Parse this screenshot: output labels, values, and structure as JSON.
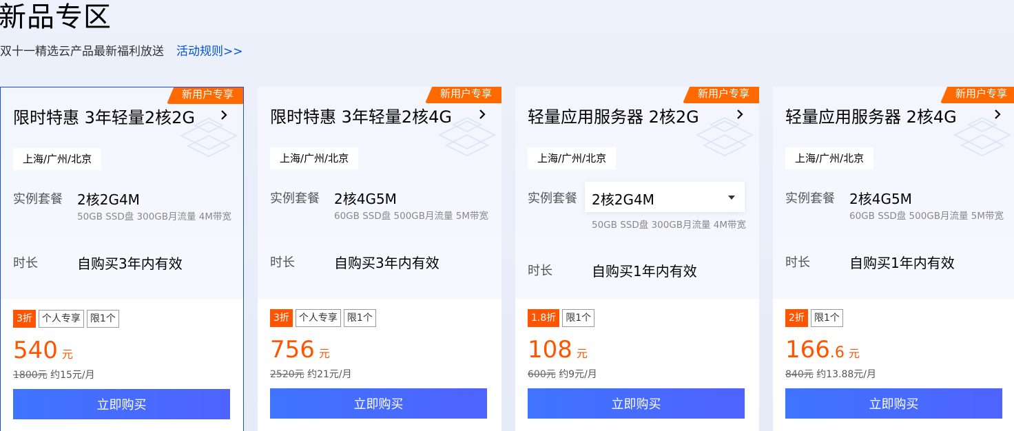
{
  "header": {
    "title": "新品专区",
    "subtitle": "双十一精选云产品最新福利放送",
    "rules_link": "活动规则>>"
  },
  "cards": [
    {
      "badge": "新用户专享",
      "title": "限时特惠 3年轻量2核2G",
      "region": "上海/广州/北京",
      "spec_label": "实例套餐",
      "spec_value": "2核2G4M",
      "spec_desc": "50GB SSD盘 300GB月流量 4M带宽",
      "duration_label": "时长",
      "duration_value": "自购买3年内有效",
      "tags": [
        "3折",
        "个人专享",
        "限1个"
      ],
      "price_int": "540",
      "price_dec": "",
      "price_unit": "元",
      "original_price": "1800元",
      "monthly": "约15元/月",
      "buy_label": "立即购买"
    },
    {
      "badge": "新用户专享",
      "title": "限时特惠 3年轻量2核4G",
      "region": "上海/广州/北京",
      "spec_label": "实例套餐",
      "spec_value": "2核4G5M",
      "spec_desc": "60GB SSD盘 500GB月流量 5M带宽",
      "duration_label": "时长",
      "duration_value": "自购买3年内有效",
      "tags": [
        "3折",
        "个人专享",
        "限1个"
      ],
      "price_int": "756",
      "price_dec": "",
      "price_unit": "元",
      "original_price": "2520元",
      "monthly": "约21元/月",
      "buy_label": "立即购买"
    },
    {
      "badge": "新用户专享",
      "title": "轻量应用服务器 2核2G",
      "region": "上海/广州/北京",
      "spec_label": "实例套餐",
      "spec_value": "2核2G4M",
      "spec_desc": "50GB SSD盘 300GB月流量 4M带宽",
      "duration_label": "时长",
      "duration_value": "自购买1年内有效",
      "tags": [
        "1.8折",
        "限1个"
      ],
      "price_int": "108",
      "price_dec": "",
      "price_unit": "元",
      "original_price": "600元",
      "monthly": "约9元/月",
      "buy_label": "立即购买"
    },
    {
      "badge": "新用户专享",
      "title": "轻量应用服务器 2核4G",
      "region": "上海/广州/北京",
      "spec_label": "实例套餐",
      "spec_value": "2核4G5M",
      "spec_desc": "60GB SSD盘 500GB月流量 5M带宽",
      "duration_label": "时长",
      "duration_value": "自购买1年内有效",
      "tags": [
        "2折",
        "限1个"
      ],
      "price_int": "166",
      "price_dec": ".6",
      "price_unit": "元",
      "original_price": "840元",
      "monthly": "约13.88元/月",
      "buy_label": "立即购买"
    }
  ],
  "colors": {
    "accent_orange": "#ff5500",
    "badge_orange": "#ff6a00",
    "button_blue": "#4a6cff",
    "link_blue": "#0052d9"
  }
}
